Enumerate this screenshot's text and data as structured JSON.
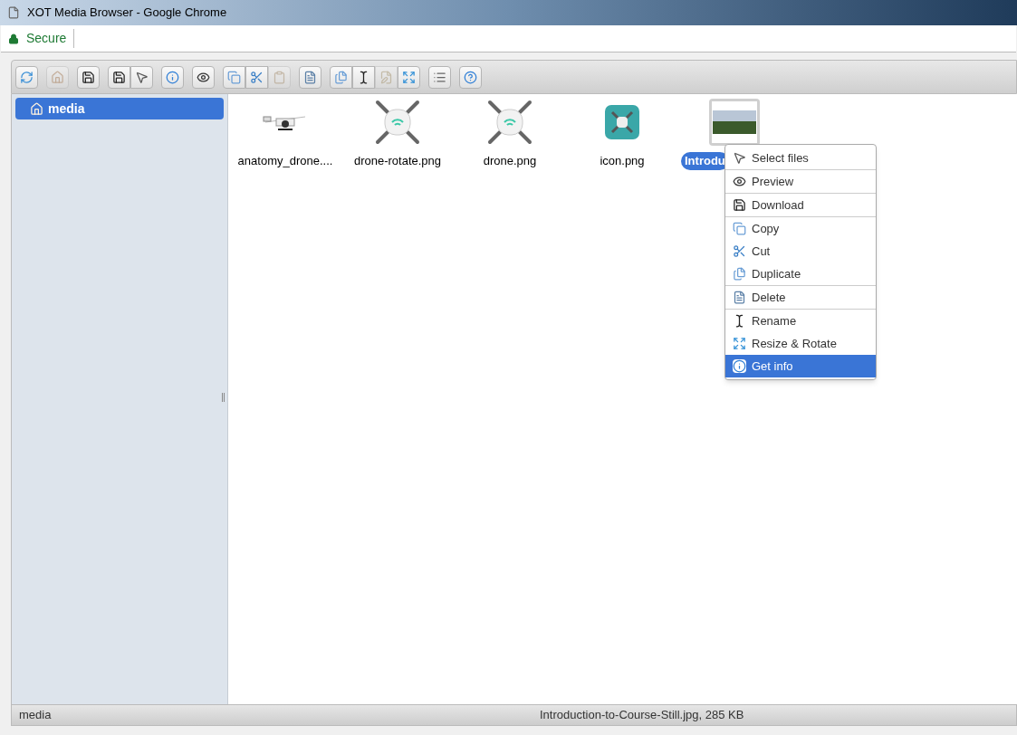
{
  "window": {
    "title": "XOT Media Browser - Google Chrome"
  },
  "address_bar": {
    "security": "Secure"
  },
  "toolbar": [
    [
      {
        "kind": "reload",
        "disabled": false
      }
    ],
    [
      {
        "kind": "home",
        "disabled": true
      }
    ],
    [
      {
        "kind": "upload",
        "disabled": false
      }
    ],
    [
      {
        "kind": "download",
        "disabled": false
      },
      {
        "kind": "select",
        "disabled": false
      }
    ],
    [
      {
        "kind": "info",
        "disabled": false
      }
    ],
    [
      {
        "kind": "preview",
        "disabled": false
      }
    ],
    [
      {
        "kind": "copy",
        "disabled": false
      },
      {
        "kind": "cut",
        "disabled": false
      },
      {
        "kind": "paste",
        "disabled": true
      }
    ],
    [
      {
        "kind": "delete",
        "disabled": false
      }
    ],
    [
      {
        "kind": "duplicate",
        "disabled": false
      },
      {
        "kind": "rename",
        "disabled": false
      },
      {
        "kind": "edit",
        "disabled": true
      },
      {
        "kind": "resize",
        "disabled": false
      }
    ],
    [
      {
        "kind": "view",
        "disabled": false
      }
    ],
    [
      {
        "kind": "help",
        "disabled": false
      }
    ]
  ],
  "sidebar": {
    "items": [
      {
        "label": "media",
        "selected": true
      }
    ]
  },
  "files": [
    {
      "name": "anatomy_drone....",
      "kind": "diagram",
      "selected": false
    },
    {
      "name": "drone-rotate.png",
      "kind": "drone",
      "selected": false
    },
    {
      "name": "drone.png",
      "kind": "drone",
      "selected": false
    },
    {
      "name": "icon.png",
      "kind": "app-icon",
      "selected": false
    },
    {
      "name": "Introdu",
      "kind": "photo",
      "selected": true
    }
  ],
  "context_menu": [
    [
      {
        "label": "Select files",
        "kind": "select",
        "selected": false
      }
    ],
    [
      {
        "label": "Preview",
        "kind": "preview",
        "selected": false
      }
    ],
    [
      {
        "label": "Download",
        "kind": "download",
        "selected": false
      }
    ],
    [
      {
        "label": "Copy",
        "kind": "copy",
        "selected": false
      },
      {
        "label": "Cut",
        "kind": "cut",
        "selected": false
      },
      {
        "label": "Duplicate",
        "kind": "duplicate",
        "selected": false
      }
    ],
    [
      {
        "label": "Delete",
        "kind": "delete",
        "selected": false
      }
    ],
    [
      {
        "label": "Rename",
        "kind": "rename",
        "selected": false
      },
      {
        "label": "Resize & Rotate",
        "kind": "resize",
        "selected": false
      },
      {
        "label": "Get info",
        "kind": "info",
        "selected": true
      }
    ]
  ],
  "status_bar": {
    "path": "media",
    "selection": "Introduction-to-Course-Still.jpg, 285 KB"
  }
}
